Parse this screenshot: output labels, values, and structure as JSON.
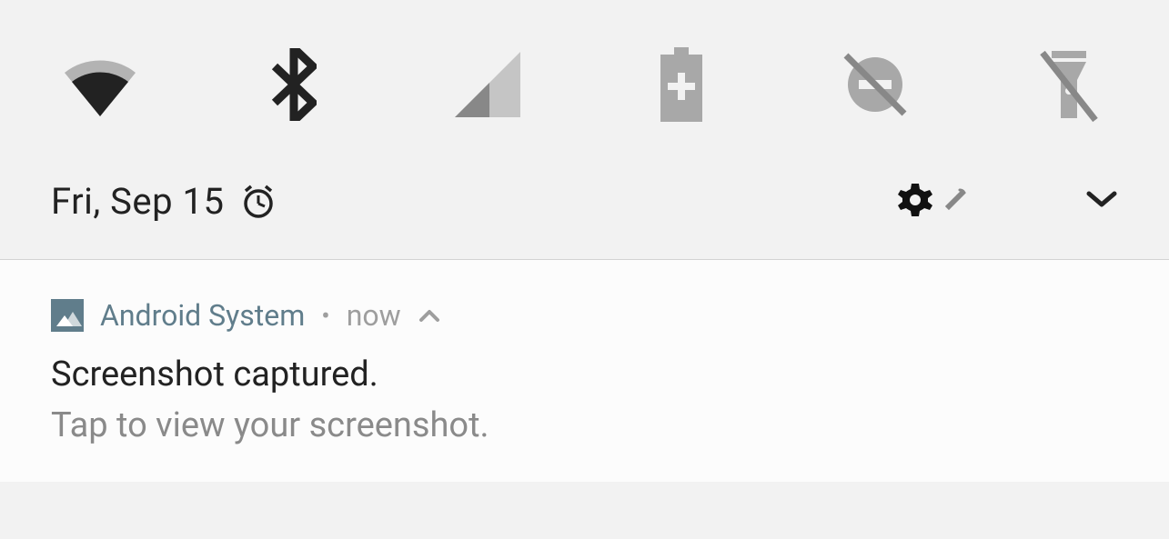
{
  "quick_settings": {
    "tiles": [
      {
        "name": "wifi"
      },
      {
        "name": "bluetooth"
      },
      {
        "name": "cellular"
      },
      {
        "name": "battery"
      },
      {
        "name": "do-not-disturb"
      },
      {
        "name": "flashlight"
      }
    ],
    "date": "Fri, Sep 15"
  },
  "notification": {
    "app_name": "Android System",
    "separator": "•",
    "timestamp": "now",
    "title": "Screenshot captured.",
    "body": "Tap to view your screenshot."
  }
}
